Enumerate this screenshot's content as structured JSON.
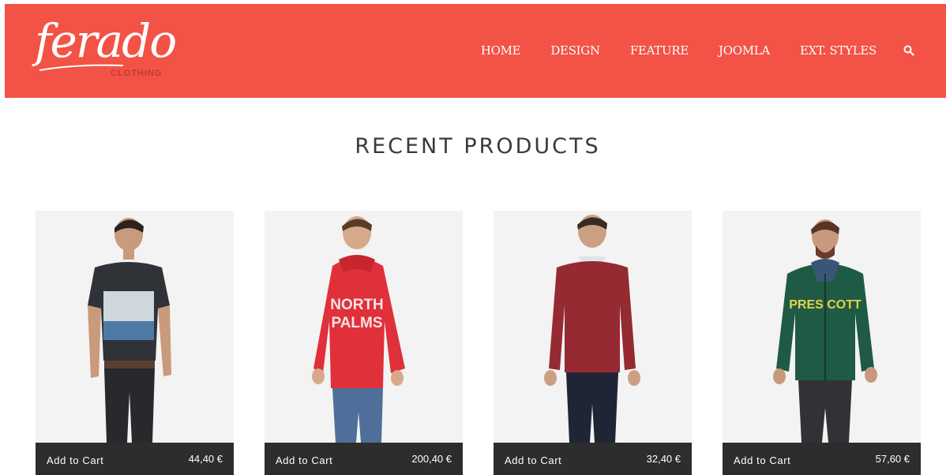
{
  "header": {
    "logo_text": "ferado",
    "logo_sub": "CLOTHING",
    "brand_color": "#f25346",
    "nav": [
      {
        "label": "HOME"
      },
      {
        "label": "DESIGN"
      },
      {
        "label": "FEATURE"
      },
      {
        "label": "JOOMLA"
      },
      {
        "label": "EXT. STYLES"
      }
    ],
    "search_icon": "search-icon"
  },
  "main": {
    "section_title": "RECENT PRODUCTS",
    "products": [
      {
        "add_to_cart": "Add to Cart",
        "price": "44,40 €",
        "image": "man-in-graphic-tshirt",
        "garment_color": "#2f3338"
      },
      {
        "add_to_cart": "Add to Cart",
        "price": "200,40 €",
        "image": "man-in-red-hoodie",
        "garment_color": "#e0303a"
      },
      {
        "add_to_cart": "Add to Cart",
        "price": "32,40 €",
        "image": "man-in-burgundy-sweater",
        "garment_color": "#962a32"
      },
      {
        "add_to_cart": "Add to Cart",
        "price": "57,60 €",
        "image": "man-in-green-zip-hoodie",
        "garment_color": "#1f5a44"
      }
    ]
  }
}
